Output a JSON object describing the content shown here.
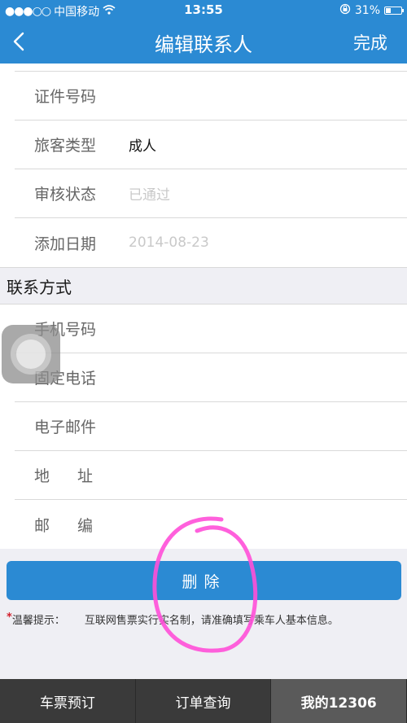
{
  "status_bar": {
    "carrier": "中国移动",
    "time": "13:55",
    "battery": "31%",
    "battery_level": 0.31
  },
  "nav": {
    "title": "编辑联系人",
    "done_label": "完成"
  },
  "info_rows": [
    {
      "label": "证件号码",
      "value": ""
    },
    {
      "label": "旅客类型",
      "value": "成人"
    },
    {
      "label": "审核状态",
      "value": "已通过"
    },
    {
      "label": "添加日期",
      "value": "2014-08-23"
    }
  ],
  "contact_section": {
    "title": "联系方式",
    "rows": [
      {
        "label": "手机号码",
        "value": ""
      },
      {
        "label": "固定电话",
        "value": ""
      },
      {
        "label": "电子邮件",
        "value": ""
      },
      {
        "label": "地址",
        "value": ""
      },
      {
        "label": "邮编",
        "value": ""
      }
    ]
  },
  "delete_label": "删除",
  "tip": {
    "label": "温馨提示：",
    "text": "互联网售票实行实名制，请准确填写乘车人基本信息。"
  },
  "tabs": [
    {
      "label": "车票预订",
      "active": false
    },
    {
      "label": "订单查询",
      "active": false
    },
    {
      "label": "我的12306",
      "active": true
    }
  ],
  "colors": {
    "accent": "#2b8ad3",
    "tab_bar": "#3a3a3a",
    "tip_star": "#d21f2b"
  }
}
